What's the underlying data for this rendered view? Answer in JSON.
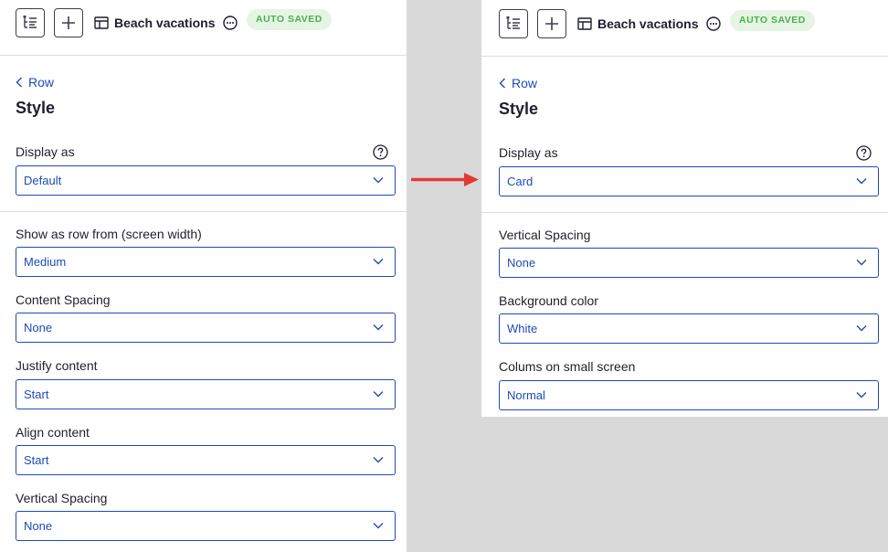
{
  "left_panel": {
    "toolbar": {
      "title": "Beach vacations",
      "badge": "AUTO SAVED"
    },
    "back_label": "Row",
    "section_title": "Style",
    "display_as": {
      "label": "Display as",
      "value": "Default"
    },
    "fields": [
      {
        "label": "Show as row from (screen width)",
        "value": "Medium"
      },
      {
        "label": "Content Spacing",
        "value": "None"
      },
      {
        "label": "Justify content",
        "value": "Start"
      },
      {
        "label": "Align content",
        "value": "Start"
      },
      {
        "label": "Vertical Spacing",
        "value": "None"
      }
    ]
  },
  "right_panel": {
    "toolbar": {
      "title": "Beach vacations",
      "badge": "AUTO SAVED"
    },
    "back_label": "Row",
    "section_title": "Style",
    "display_as": {
      "label": "Display as",
      "value": "Card"
    },
    "fields": [
      {
        "label": "Vertical Spacing",
        "value": "None"
      },
      {
        "label": "Background color",
        "value": "White"
      },
      {
        "label": "Colums on small screen",
        "value": "Normal"
      }
    ]
  },
  "colors": {
    "accent": "#1c4bb8",
    "badge_bg": "#e6f4e3",
    "badge_text": "#4caf50",
    "arrow": "#e53935"
  }
}
